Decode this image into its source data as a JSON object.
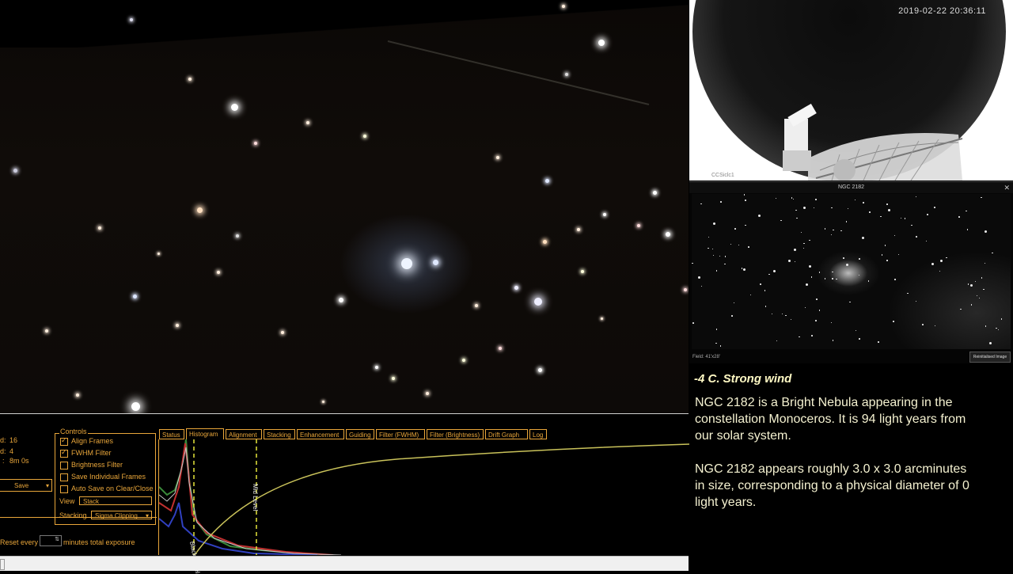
{
  "allsky": {
    "timestamp": "2019-02-22 20:36:11",
    "corner_label": "CCSiclc1"
  },
  "ngc_panel": {
    "title": "NGC 2182",
    "field_label": "Field: 41'x28'",
    "button_label": "Reinitialised Image"
  },
  "info": {
    "weather": "-4 C. Strong wind",
    "paragraph1_line1": "NGC 2182 is a Bright Nebula appearing in the",
    "paragraph1_line2": "constellation Monoceros. It is 94 light years from",
    "paragraph1_line3": "our solar system.",
    "paragraph2_line1": "NGC 2182 appears roughly 3.0 x 3.0 arcminutes",
    "paragraph2_line2": "in size, corresponding to a physical diameter of 0",
    "paragraph2_line3": "light years."
  },
  "left_panel": {
    "stacked_label": "d:",
    "stacked_value": "16",
    "ignored_label": "d:",
    "ignored_value": "4",
    "time_label": ":",
    "time_value": "8m 0s",
    "save_label": "Save",
    "reset_label": "Reset every",
    "reset_suffix": "minutes total exposure"
  },
  "controls": {
    "group_label": "Controls",
    "checks": [
      {
        "label": "Align Frames",
        "checked": true
      },
      {
        "label": "FWHM Filter",
        "checked": true
      },
      {
        "label": "Brightness Filter",
        "checked": false
      },
      {
        "label": "Save Individual Frames",
        "checked": false
      },
      {
        "label": "Auto Save on Clear/Close",
        "checked": false
      }
    ],
    "view_label": "View",
    "view_value": "Stack",
    "stacking_label": "Stacking",
    "stacking_value": "Sigma Clipping"
  },
  "tabs": [
    "Status",
    "Histogram",
    "Alignment",
    "Stacking",
    "Enhancement",
    "Guiding",
    "Filter (FWHM)",
    "Filter (Brightness)",
    "Drift Graph",
    "Log"
  ],
  "active_tab": "Histogram",
  "histogram": {
    "black_label": "Black Level",
    "mid_label": "Mid Level"
  },
  "colors": {
    "accent": "#e9a63a",
    "info_text": "#f4f1d0",
    "weather_text": "#fff9c4"
  }
}
